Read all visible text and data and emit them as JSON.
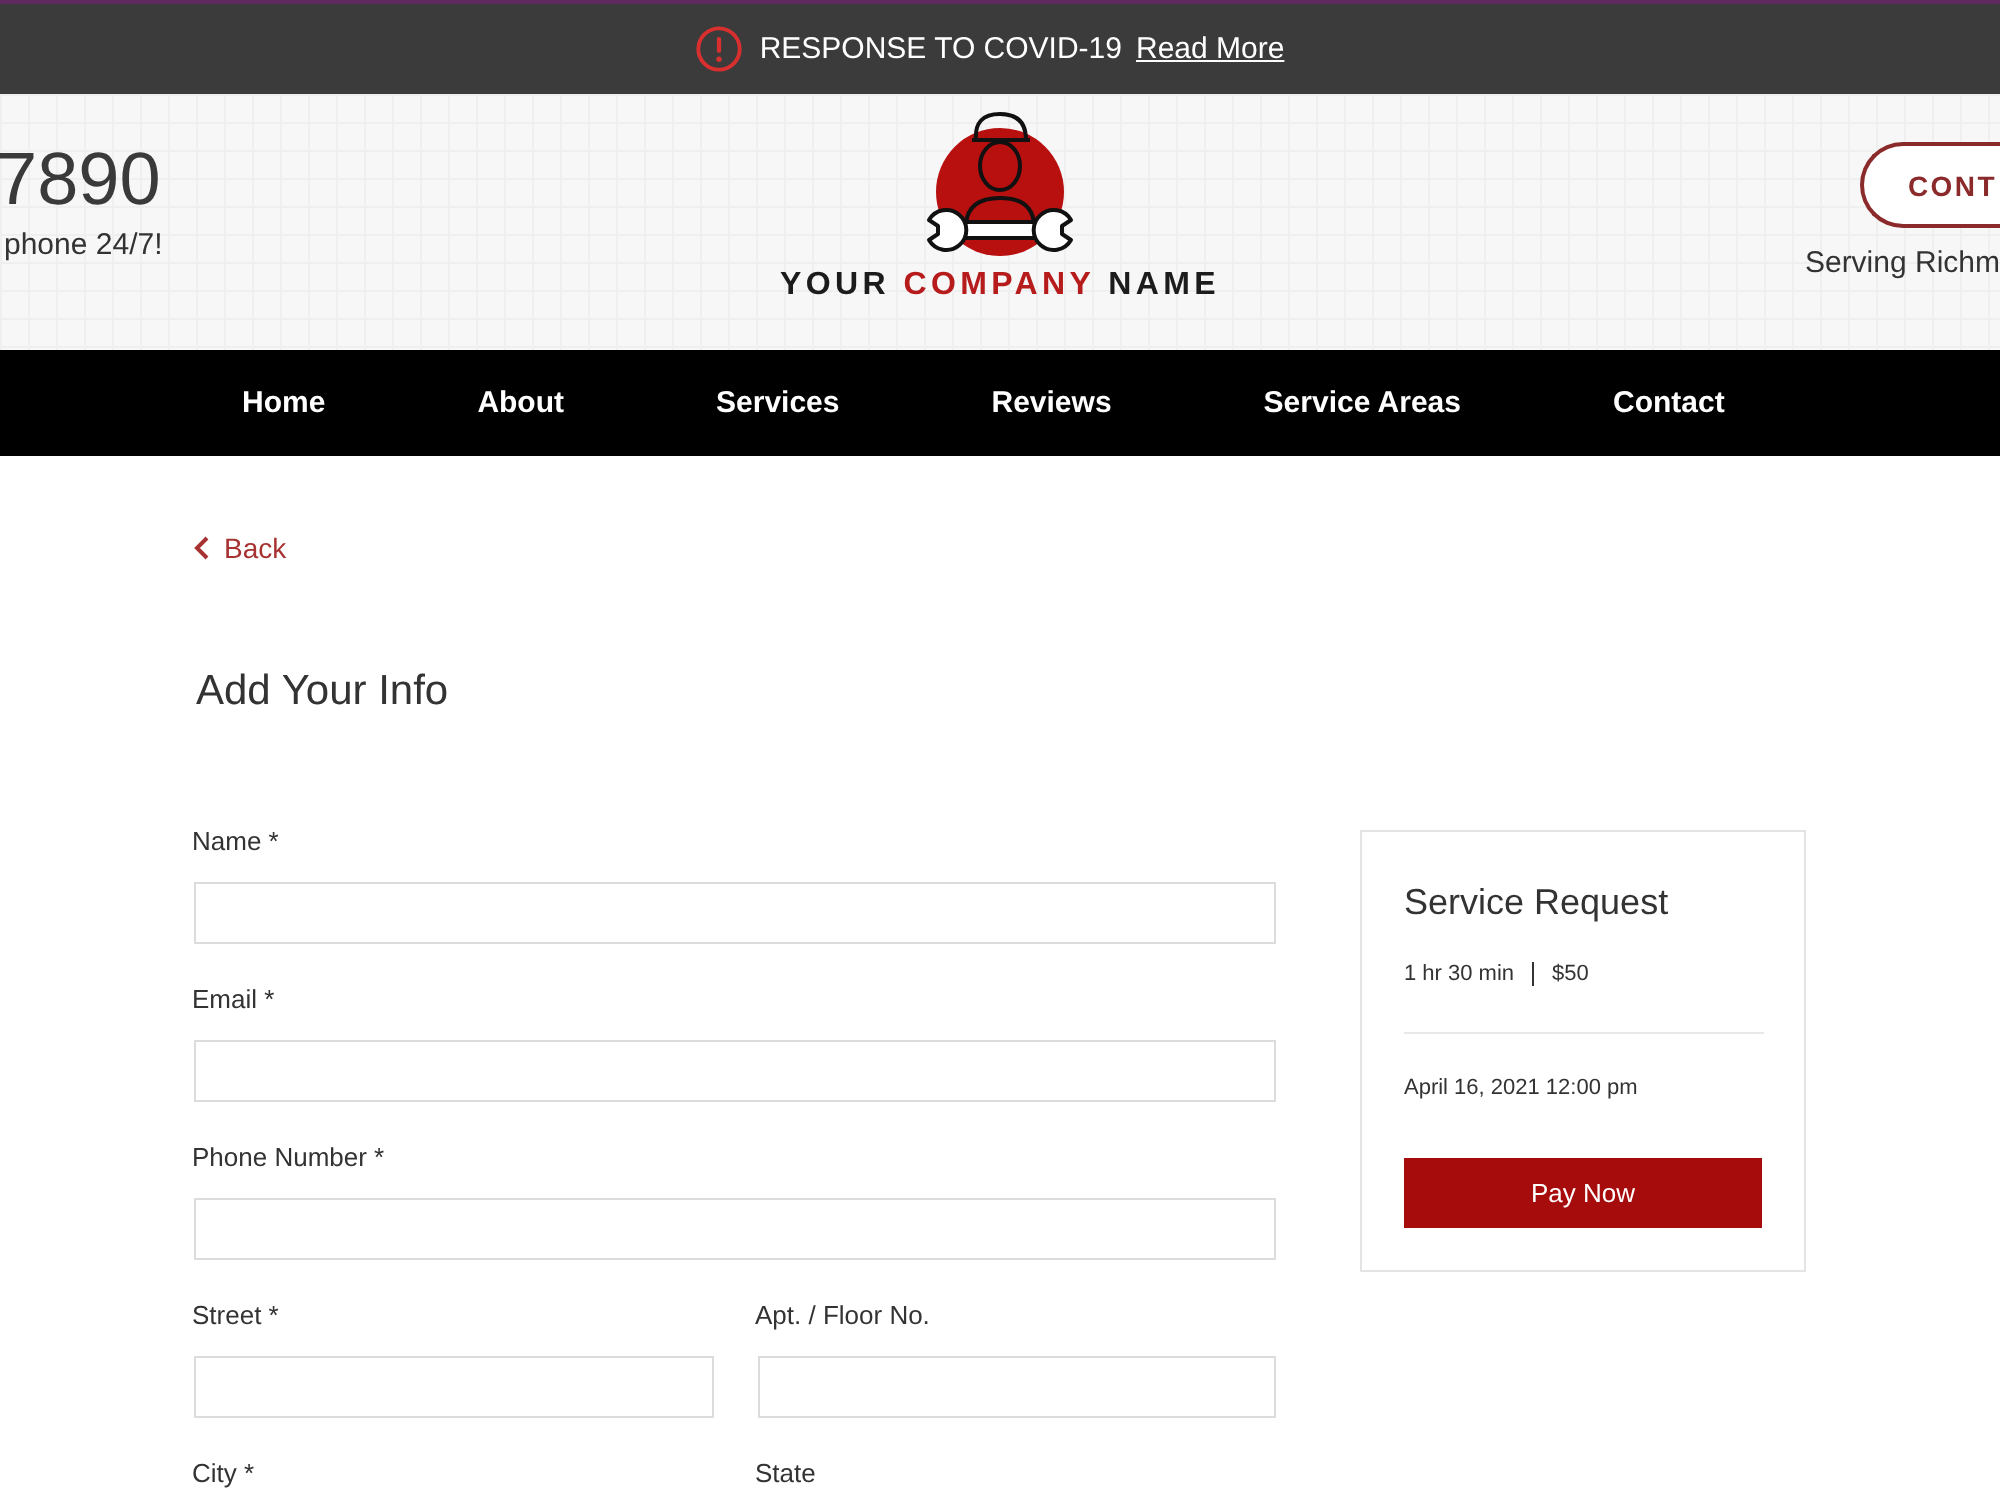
{
  "banner": {
    "message": "RESPONSE TO COVID-19",
    "link": "Read More"
  },
  "header": {
    "phone": "7890",
    "phone_note": "phone 24/7!",
    "logo": {
      "words": [
        {
          "text": "YOUR",
          "highlighted": false
        },
        {
          "text": "COMPANY",
          "highlighted": true
        },
        {
          "text": "NAME",
          "highlighted": false
        }
      ]
    },
    "contact_button": "CONT",
    "serving": "Serving Richm"
  },
  "nav": [
    {
      "label": "Home"
    },
    {
      "label": "About"
    },
    {
      "label": "Services"
    },
    {
      "label": "Reviews"
    },
    {
      "label": "Service Areas"
    },
    {
      "label": "Contact"
    }
  ],
  "back_link": "Back",
  "form": {
    "title": "Add Your Info",
    "rows": [
      [
        {
          "label": "Name *",
          "kind": "field"
        }
      ],
      [
        {
          "label": "Email *",
          "kind": "field"
        }
      ],
      [
        {
          "label": "Phone Number *",
          "kind": "field"
        }
      ],
      [
        {
          "label": "Street *",
          "kind": "field"
        },
        {
          "label": "Apt. / Floor No.",
          "kind": "field"
        }
      ],
      [
        {
          "label": "City *",
          "kind": "label"
        },
        {
          "label": "State",
          "kind": "label"
        }
      ]
    ]
  },
  "summary": {
    "title": "Service Request",
    "duration": "1 hr 30 min",
    "price": "$50",
    "date": "April 16, 2021 12:00 pm",
    "button": "Pay Now"
  }
}
